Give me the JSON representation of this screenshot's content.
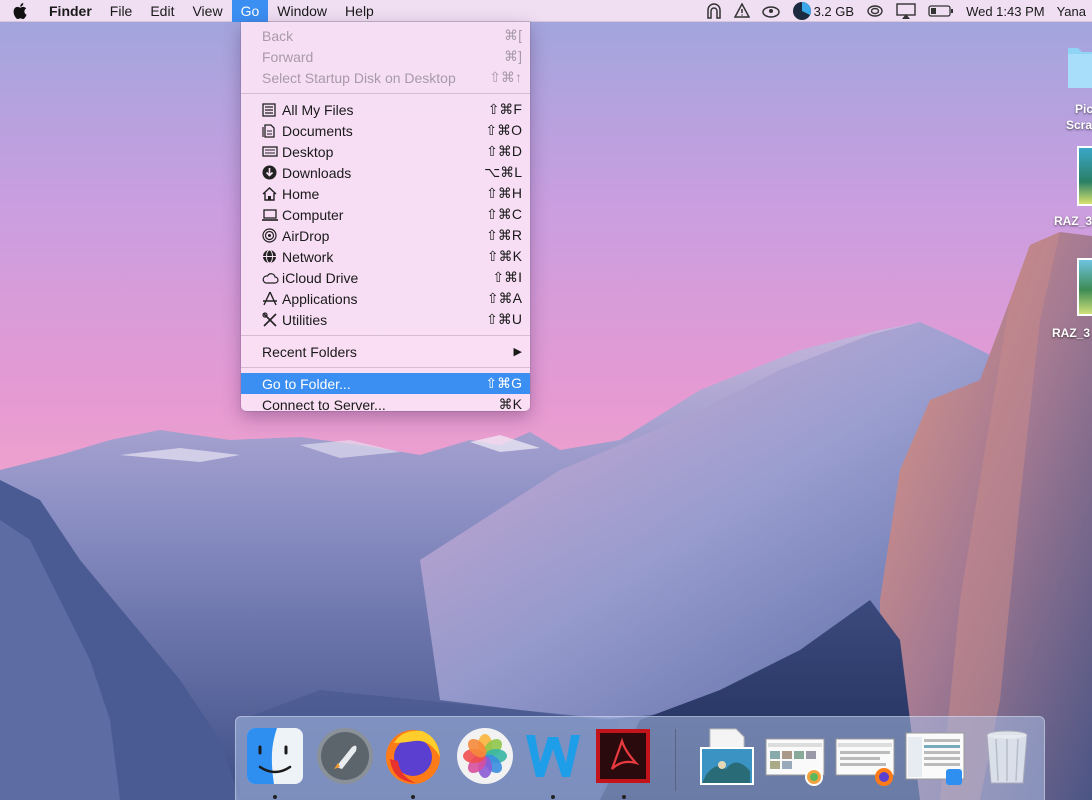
{
  "menubar": {
    "app_name": "Finder",
    "menus": [
      "File",
      "Edit",
      "View",
      "Go",
      "Window",
      "Help"
    ],
    "active_menu": "Go",
    "memory": "3.2 GB",
    "clock": "Wed 1:43 PM",
    "user": "Yana"
  },
  "go_menu": {
    "group1": [
      {
        "label": "Back",
        "shortcut": "⌘[",
        "disabled": true
      },
      {
        "label": "Forward",
        "shortcut": "⌘]",
        "disabled": true
      },
      {
        "label": "Select Startup Disk on Desktop",
        "shortcut": "⇧⌘↑",
        "disabled": true
      }
    ],
    "group2": [
      {
        "label": "All My Files",
        "shortcut": "⇧⌘F",
        "icon": "all-files-icon"
      },
      {
        "label": "Documents",
        "shortcut": "⇧⌘O",
        "icon": "documents-icon"
      },
      {
        "label": "Desktop",
        "shortcut": "⇧⌘D",
        "icon": "desktop-icon"
      },
      {
        "label": "Downloads",
        "shortcut": "⌥⌘L",
        "icon": "downloads-icon"
      },
      {
        "label": "Home",
        "shortcut": "⇧⌘H",
        "icon": "home-icon"
      },
      {
        "label": "Computer",
        "shortcut": "⇧⌘C",
        "icon": "computer-icon"
      },
      {
        "label": "AirDrop",
        "shortcut": "⇧⌘R",
        "icon": "airdrop-icon"
      },
      {
        "label": "Network",
        "shortcut": "⇧⌘K",
        "icon": "network-icon"
      },
      {
        "label": "iCloud Drive",
        "shortcut": "⇧⌘I",
        "icon": "icloud-icon"
      },
      {
        "label": "Applications",
        "shortcut": "⇧⌘A",
        "icon": "applications-icon"
      },
      {
        "label": "Utilities",
        "shortcut": "⇧⌘U",
        "icon": "utilities-icon"
      }
    ],
    "recent_folders": "Recent Folders",
    "go_to_folder": {
      "label": "Go to Folder...",
      "shortcut": "⇧⌘G"
    },
    "connect_to_server": {
      "label": "Connect to Server...",
      "shortcut": "⌘K"
    }
  },
  "desktop_icons": [
    {
      "label": "Pic",
      "label2": "Scra"
    },
    {
      "label": "RAZ_3"
    },
    {
      "label": "RAZ_3"
    }
  ],
  "dock": {
    "apps": [
      "finder-icon",
      "launchpad-icon",
      "firefox-icon",
      "photos-icon",
      "word-icon",
      "acrobat-icon"
    ],
    "trash": "trash-icon"
  },
  "colors": {
    "accent": "#3b8ef2",
    "menu_bg": "#fae2f6"
  }
}
